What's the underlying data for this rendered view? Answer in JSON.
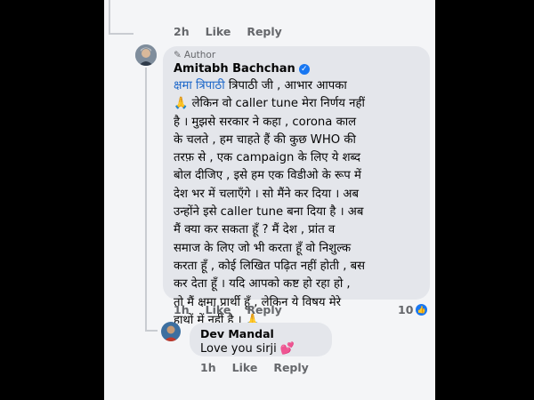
{
  "top_reply": {
    "time": "2h",
    "like": "Like",
    "reply": "Reply"
  },
  "main_comment": {
    "author_tag": "Author",
    "author_name": "Amitabh Bachchan",
    "mention": "क्षमा त्रिपाठी",
    "text_after_mention": " त्रिपाठी जी , आभार आपका\n🙏 लेकिन वो caller tune मेरा निर्णय नहीं\nहै । मुझसे सरकार ने कहा , corona काल\nके चलते , हम चाहते हैं की कुछ WHO की\nतरफ़ से , एक campaign के लिए ये शब्द\nबोल दीजिए , इसे हम एक विडीओ के रूप में\nदेश भर में चलाएँगे । सो मैंने  कर दिया । अब\nउन्होंने इसे caller tune बना दिया है । अब\nमैं  क्या कर सकता हूँ  ? मैं देश , प्रांत व\nसमाज के लिए जो भी करता हूँ वो निशुल्क\nकरता हूँ , कोई लिखित पढ़ित नहीं होती , बस\nकर देता हूँ  । यदि आपको कष्ट हो रहा हो ,\nतो मैं  क्षमा प्रार्थी हूँ , लेकिन ये विषय मेरे\nहाथों में नहीं है  । 🙏",
    "time": "1h",
    "like": "Like",
    "reply": "Reply",
    "reaction_count": "10"
  },
  "reply_comment": {
    "author_name": "Dev Mandal",
    "text": "Love you sirji 💕",
    "time": "1h",
    "like": "Like",
    "reply": "Reply"
  },
  "colors": {
    "panel": "#f4f5f7",
    "bubble": "#e4e6eb",
    "link": "#1b66c9",
    "meta": "#65676b",
    "verified": "#1877f2"
  }
}
